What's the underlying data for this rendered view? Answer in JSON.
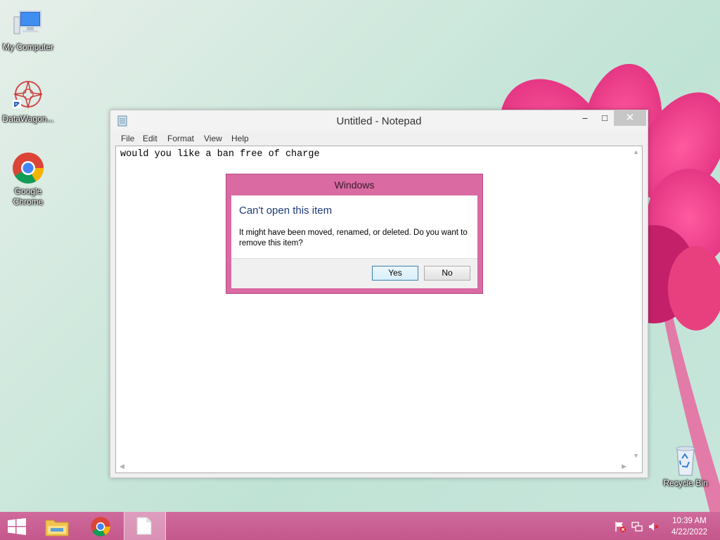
{
  "desktop": {
    "icons": [
      {
        "label": "My Computer",
        "icon": "computer-icon"
      },
      {
        "label": "DataWagon...",
        "icon": "datawagon-icon"
      },
      {
        "label": "Google Chrome",
        "icon": "chrome-icon"
      },
      {
        "label": "Recycle Bin",
        "icon": "recycle-bin-icon"
      }
    ]
  },
  "notepad": {
    "title": "Untitled - Notepad",
    "menu": [
      "File",
      "Edit",
      "Format",
      "View",
      "Help"
    ],
    "content": "would you like a ban free of charge",
    "controls": {
      "minimize": "–",
      "maximize": "□",
      "close": "✕"
    }
  },
  "dialog": {
    "title": "Windows",
    "heading": "Can't open this item",
    "message": "It might have been moved, renamed, or deleted. Do you want to remove this item?",
    "yes_label": "Yes",
    "no_label": "No"
  },
  "taskbar": {
    "items": [
      "start-icon",
      "file-explorer-icon",
      "chrome-icon",
      "notepad-icon"
    ],
    "tray": [
      "flag-icon",
      "network-icon",
      "volume-muted-icon"
    ],
    "time": "10:39 AM",
    "date": "4/22/2022"
  },
  "colors": {
    "accent": "#d96aa2",
    "taskbar": "#c75a8f",
    "dialog_heading": "#1e3a78"
  }
}
